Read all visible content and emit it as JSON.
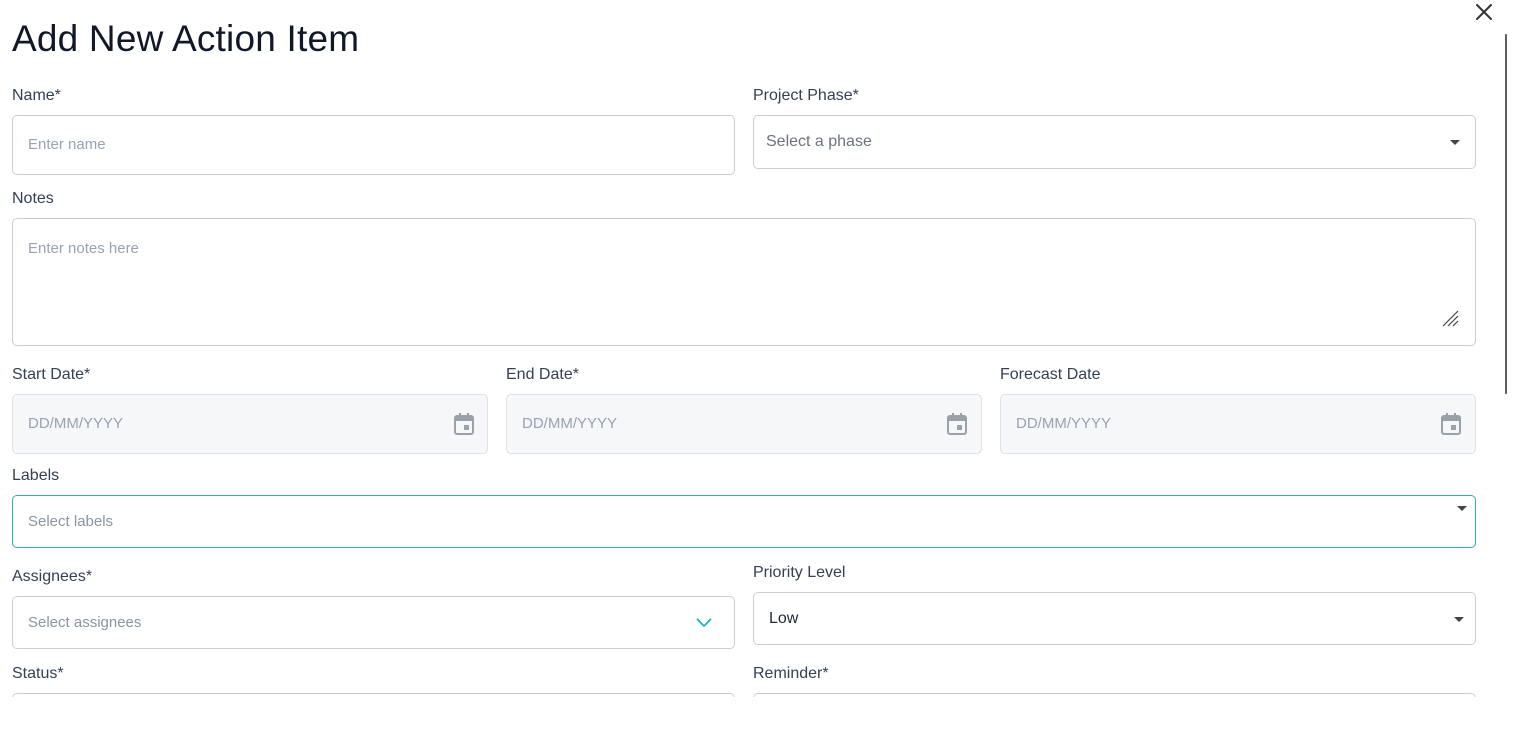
{
  "dialog": {
    "title": "Add New Action Item"
  },
  "fields": {
    "name": {
      "label": "Name*",
      "placeholder": "Enter name"
    },
    "project_phase": {
      "label": "Project Phase*",
      "placeholder": "Select a phase"
    },
    "notes": {
      "label": "Notes",
      "placeholder": "Enter notes here"
    },
    "start_date": {
      "label": "Start Date*",
      "placeholder": "DD/MM/YYYY"
    },
    "end_date": {
      "label": "End Date*",
      "placeholder": "DD/MM/YYYY"
    },
    "forecast_date": {
      "label": "Forecast Date",
      "placeholder": "DD/MM/YYYY"
    },
    "labels": {
      "label": "Labels",
      "placeholder": "Select labels"
    },
    "assignees": {
      "label": "Assignees*",
      "placeholder": "Select assignees"
    },
    "priority": {
      "label": "Priority Level",
      "value": "Low"
    },
    "status": {
      "label": "Status*"
    },
    "reminder": {
      "label": "Reminder*"
    }
  },
  "icons": {
    "close": "close-icon",
    "calendar": "calendar-icon",
    "caret": "caret-down-icon",
    "chevron": "chevron-down-icon",
    "resize": "resize-handle-icon"
  },
  "colors": {
    "focus_border": "#2bb5a8",
    "chevron": "#19b6c9",
    "placeholder": "#98a2b3"
  }
}
